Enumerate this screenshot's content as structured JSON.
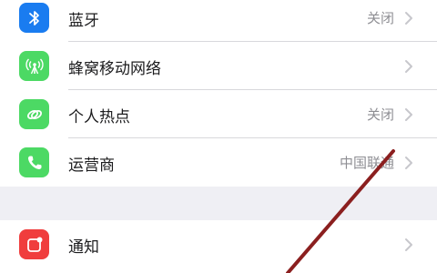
{
  "settings": {
    "group1": [
      {
        "label": "蓝牙",
        "value": "关闭",
        "icon": "bluetooth-icon",
        "color": "#1a7cf0"
      },
      {
        "label": "蜂窝移动网络",
        "value": "",
        "icon": "cellular-antenna-icon",
        "color": "#4cd964"
      },
      {
        "label": "个人热点",
        "value": "关闭",
        "icon": "hotspot-link-icon",
        "color": "#4cd964"
      },
      {
        "label": "运营商",
        "value": "中国联通",
        "icon": "phone-icon",
        "color": "#4cd964"
      }
    ],
    "group2": [
      {
        "label": "通知",
        "value": "",
        "icon": "notifications-icon",
        "color": "#f03d3d"
      }
    ]
  },
  "annotation": {
    "color": "#8b1f1f"
  }
}
